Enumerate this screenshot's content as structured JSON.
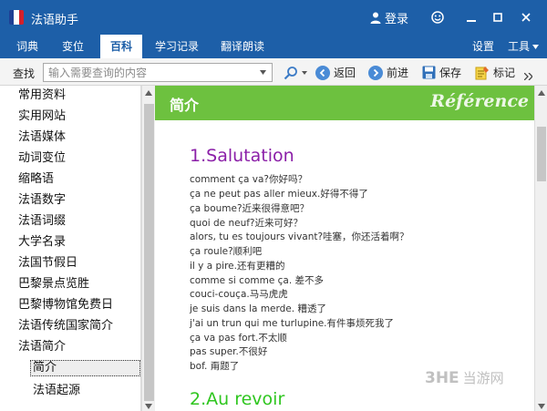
{
  "window": {
    "title": "法语助手",
    "login_label": "登录",
    "flag_colors": [
      "#1f3f94",
      "#ffffff",
      "#d5202a"
    ]
  },
  "menu": {
    "items": [
      {
        "label": "词典"
      },
      {
        "label": "变位"
      },
      {
        "label": "百科",
        "active": true
      },
      {
        "label": "学习记录"
      },
      {
        "label": "翻译朗读"
      }
    ],
    "settings_label": "设置",
    "tools_label": "工具"
  },
  "toolbar": {
    "find_label": "查找",
    "search_placeholder": "输入需要查询的内容",
    "back_label": "返回",
    "forward_label": "前进",
    "save_label": "保存",
    "bookmark_label": "标记"
  },
  "sidebar": {
    "items": [
      {
        "label": "常用资料"
      },
      {
        "label": "实用网站"
      },
      {
        "label": "法语媒体"
      },
      {
        "label": "动词变位"
      },
      {
        "label": "缩略语"
      },
      {
        "label": "法语数字"
      },
      {
        "label": "法语词缀"
      },
      {
        "label": "大学名录"
      },
      {
        "label": "法国节假日"
      },
      {
        "label": "巴黎景点览胜"
      },
      {
        "label": "巴黎博物馆免费日"
      },
      {
        "label": "法语传统国家简介"
      },
      {
        "label": "法语简介"
      },
      {
        "label": "简介",
        "selected": true
      },
      {
        "label": "法语起源"
      }
    ]
  },
  "content": {
    "banner_title": "简介",
    "banner_subtitle": "Référence",
    "banner_color": "#6dc13f",
    "section1_title": "1.Salutation",
    "section1_color": "#8b1fa8",
    "lines": [
      "comment ça va?你好吗？",
      "ça ne peut pas aller mieux.好得不得了",
      "ça boume?近来很得意吧？",
      "quoi de neuf?近来可好？",
      "alors, tu es toujours vivant?哇塞，你还活着啊？",
      "ça roule?顺利吧",
      "il y a pire.还有更糟的",
      "comme si comme ça. 差不多",
      "couci-couça.马马虎虎",
      "je suis dans la merde. 糟透了",
      "j'ai un trun qui me turlupine.有件事烦死我了",
      "ça va pas fort.不太顺",
      "pas super.不很好",
      "bof. 甭题了"
    ],
    "section2_title": "2.Au revoir",
    "section2_color": "#2fc61f"
  },
  "watermark": {
    "brand": "3HE",
    "text": "当游网"
  }
}
